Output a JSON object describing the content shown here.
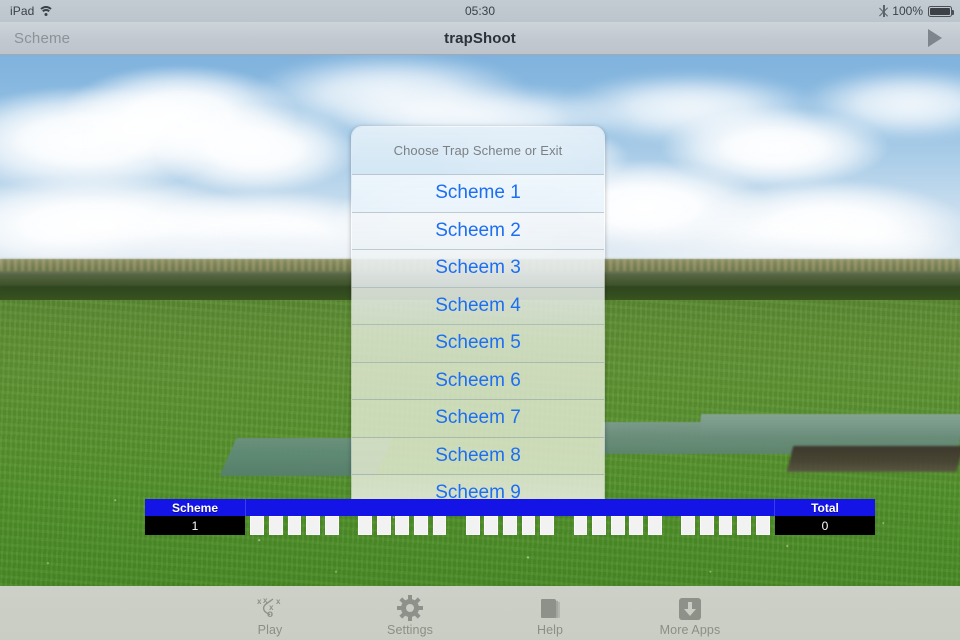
{
  "status_bar": {
    "carrier": "iPad",
    "wifi_icon": "wifi-icon",
    "time": "05:30",
    "bluetooth_icon": "bluetooth-icon",
    "battery_percent": "100%",
    "battery_icon": "battery-full-icon"
  },
  "nav_bar": {
    "back_label": "Scheme",
    "title": "trapShoot",
    "play_icon": "play-triangle-icon"
  },
  "action_sheet": {
    "header": "Choose Trap Scheme or Exit",
    "options": [
      "Scheme 1",
      "Scheem 2",
      "Scheem 3",
      "Scheem 4",
      "Scheem 5",
      "Scheem 6",
      "Scheem 7",
      "Scheem 8",
      "Scheem 9"
    ]
  },
  "score_bar": {
    "scheme_label": "Scheme",
    "scheme_value": "1",
    "total_label": "Total",
    "total_value": "0",
    "shots_per_station": 5,
    "stations": 5,
    "hit_marks": 25,
    "bar_color": "#1414e6",
    "value_bg": "#000000"
  },
  "tab_bar": {
    "items": [
      {
        "label": "Play",
        "icon": "playbook-xo-icon"
      },
      {
        "label": "Settings",
        "icon": "gear-icon"
      },
      {
        "label": "Help",
        "icon": "book-icon"
      },
      {
        "label": "More Apps",
        "icon": "download-box-icon"
      }
    ]
  },
  "colors": {
    "accent_blue": "#1c6ef2",
    "scorebar_blue": "#1414e6",
    "chrome_gray": "#c2c9d0",
    "tabbar_gray": "#c9cdc3"
  }
}
